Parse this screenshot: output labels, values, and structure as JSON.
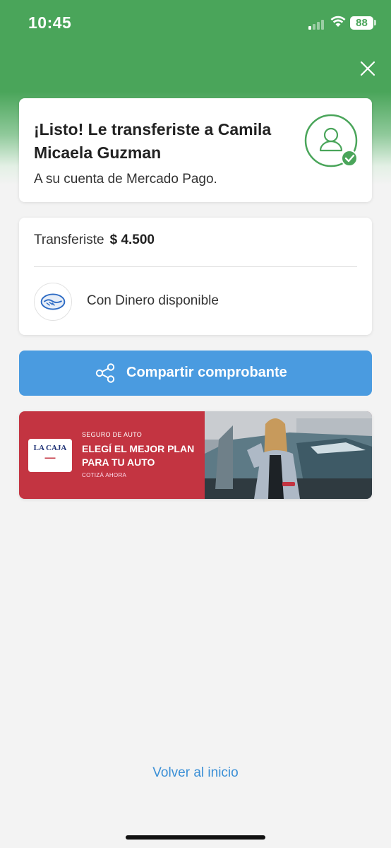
{
  "status_bar": {
    "time": "10:45",
    "battery": "88"
  },
  "success_card": {
    "title": "¡Listo! Le transferiste a Camila Micaela Guzman",
    "subtitle": "A su cuenta de Mercado Pago."
  },
  "detail_card": {
    "label": "Transferiste",
    "amount": "$ 4.500",
    "method": "Con Dinero disponible"
  },
  "share_button": {
    "label": "Compartir comprobante"
  },
  "banner": {
    "logo_text": "LA CAJA",
    "kicker": "SEGURO DE AUTO",
    "headline": "ELEGÍ EL MEJOR PLAN PARA TU AUTO",
    "cta": "COTIZÁ AHORA"
  },
  "back_link": "Volver al inicio",
  "colors": {
    "header_green": "#4aa55a",
    "button_blue": "#4a9be0",
    "link_blue": "#3a8fd6",
    "banner_red": "#c33441",
    "success_green": "#4aa55a"
  }
}
